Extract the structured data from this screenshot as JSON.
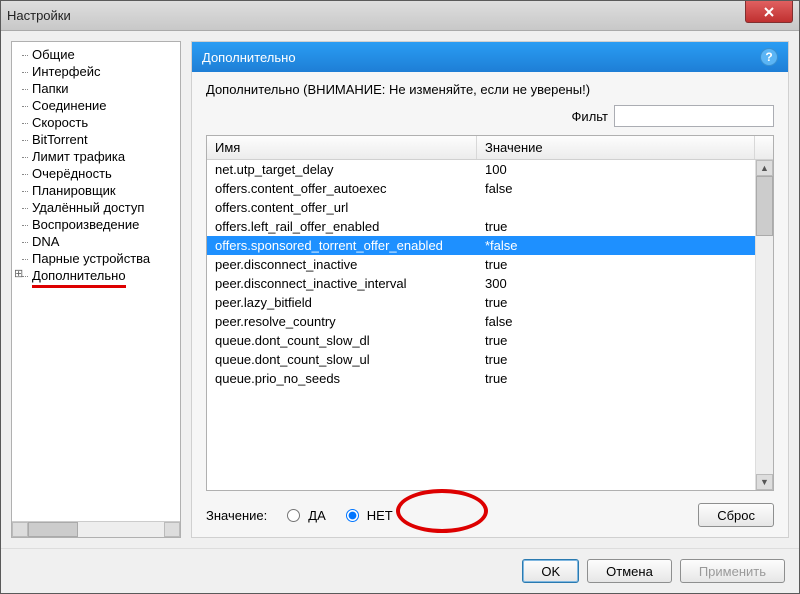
{
  "window": {
    "title": "Настройки"
  },
  "sidebar": {
    "items": [
      "Общие",
      "Интерфейс",
      "Папки",
      "Соединение",
      "Скорость",
      "BitTorrent",
      "Лимит трафика",
      "Очерёдность",
      "Планировщик",
      "Удалённый доступ",
      "Воспроизведение",
      "DNA",
      "Парные устройства",
      "Дополнительно"
    ],
    "expandable_index": 13,
    "highlighted_index": 13
  },
  "panel": {
    "title": "Дополнительно",
    "warning": "Дополнительно (ВНИМАНИЕ: Не изменяйте, если не уверены!)",
    "filter_label": "Фильт",
    "filter_value": ""
  },
  "table": {
    "headers": {
      "name": "Имя",
      "value": "Значение"
    },
    "rows": [
      {
        "name": "net.utp_target_delay",
        "value": "100",
        "selected": false
      },
      {
        "name": "offers.content_offer_autoexec",
        "value": "false",
        "selected": false
      },
      {
        "name": "offers.content_offer_url",
        "value": "",
        "selected": false
      },
      {
        "name": "offers.left_rail_offer_enabled",
        "value": "true",
        "selected": false
      },
      {
        "name": "offers.sponsored_torrent_offer_enabled",
        "value": "*false",
        "selected": true
      },
      {
        "name": "peer.disconnect_inactive",
        "value": "true",
        "selected": false
      },
      {
        "name": "peer.disconnect_inactive_interval",
        "value": "300",
        "selected": false
      },
      {
        "name": "peer.lazy_bitfield",
        "value": "true",
        "selected": false
      },
      {
        "name": "peer.resolve_country",
        "value": "false",
        "selected": false
      },
      {
        "name": "queue.dont_count_slow_dl",
        "value": "true",
        "selected": false
      },
      {
        "name": "queue.dont_count_slow_ul",
        "value": "true",
        "selected": false
      },
      {
        "name": "queue.prio_no_seeds",
        "value": "true",
        "selected": false
      }
    ]
  },
  "value_editor": {
    "label": "Значение:",
    "yes": "ДА",
    "no": "НЕТ",
    "selected": "no",
    "reset": "Сброс"
  },
  "buttons": {
    "ok": "OK",
    "cancel": "Отмена",
    "apply": "Применить"
  }
}
